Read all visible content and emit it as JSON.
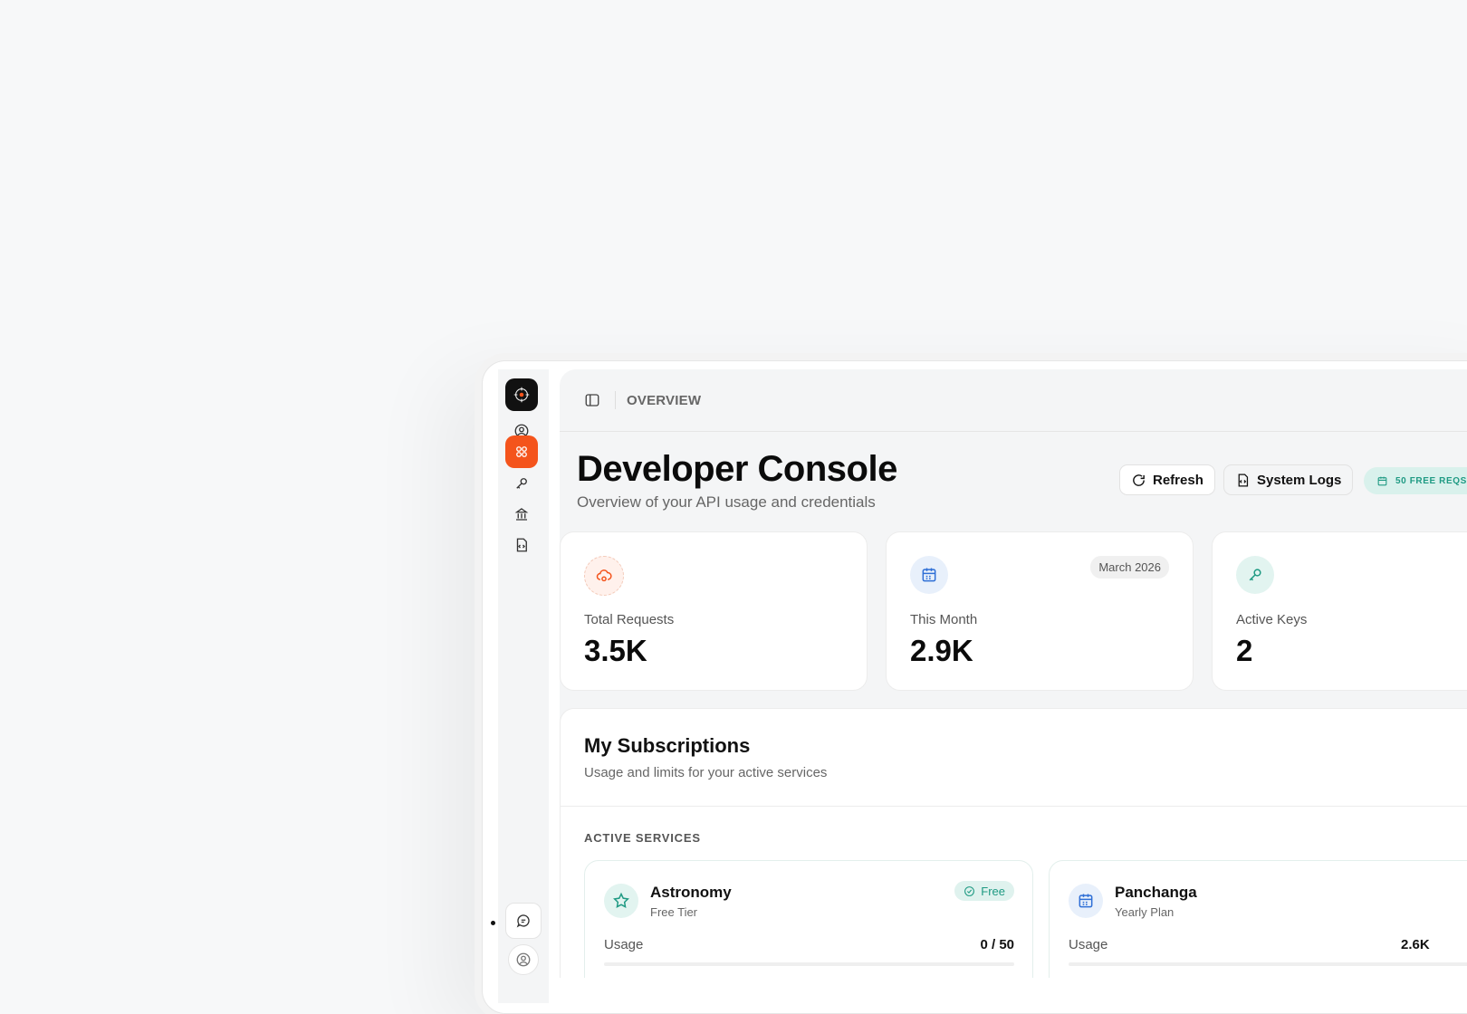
{
  "header": {
    "breadcrumb": "OVERVIEW"
  },
  "page": {
    "title": "Developer Console",
    "subtitle": "Overview of your API usage and credentials"
  },
  "actions": {
    "refresh_label": "Refresh",
    "system_logs_label": "System Logs",
    "free_requests_badge": "50 FREE REQS"
  },
  "stats": [
    {
      "label": "Total Requests",
      "value": "3.5K",
      "icon": "cloud-gear-icon"
    },
    {
      "label": "This Month",
      "value": "2.9K",
      "pill": "March 2026",
      "icon": "calendar-icon"
    },
    {
      "label": "Active Keys",
      "value": "2",
      "icon": "key-icon"
    }
  ],
  "subscriptions": {
    "title": "My Subscriptions",
    "subtitle": "Usage and limits for your active services",
    "section_label": "ACTIVE SERVICES",
    "services": [
      {
        "name": "Astronomy",
        "plan": "Free Tier",
        "tag": "Free",
        "usage_label": "Usage",
        "usage_value": "0 / 50",
        "icon": "star-icon"
      },
      {
        "name": "Panchanga",
        "plan": "Yearly Plan",
        "usage_label": "Usage",
        "usage_value": "2.6K",
        "icon": "calendar-icon"
      }
    ]
  },
  "colors": {
    "accent": "#f4541c",
    "teal": "#1f9a83",
    "blue": "#2f6fd6"
  }
}
